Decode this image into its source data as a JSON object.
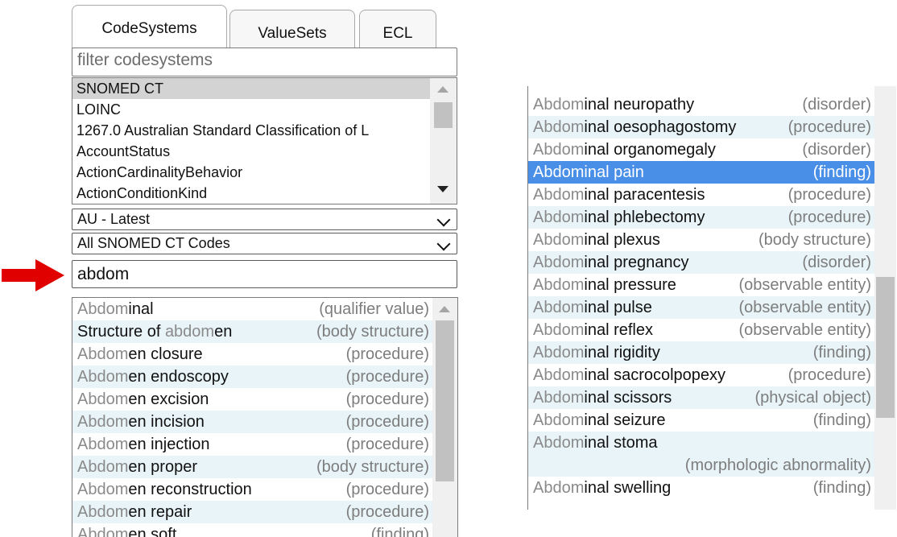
{
  "tabs": [
    {
      "label": "CodeSystems",
      "active": true
    },
    {
      "label": "ValueSets",
      "active": false
    },
    {
      "label": "ECL",
      "active": false
    }
  ],
  "filter": {
    "placeholder": "filter codesystems"
  },
  "codesystems": [
    {
      "label": "SNOMED CT",
      "selected": true
    },
    {
      "label": "LOINC"
    },
    {
      "label": "1267.0 Australian Standard Classification of L"
    },
    {
      "label": "AccountStatus"
    },
    {
      "label": "ActionCardinalityBehavior"
    },
    {
      "label": "ActionConditionKind"
    }
  ],
  "version_select": {
    "value": "AU - Latest"
  },
  "scope_select": {
    "value": "All SNOMED CT Codes"
  },
  "search": {
    "value": "abdom"
  },
  "colors": {
    "selected_row": "#4a8fe7",
    "alt_row": "#e8f4f8",
    "arrow": "#e00000"
  },
  "results_left": [
    {
      "pre": "",
      "match": "Abdom",
      "rest": "inal",
      "semantic": "(qualifier value)"
    },
    {
      "pre": "Structure of ",
      "match": "abdom",
      "rest": "en",
      "semantic": "(body structure)"
    },
    {
      "pre": "",
      "match": "Abdom",
      "rest": "en closure",
      "semantic": "(procedure)"
    },
    {
      "pre": "",
      "match": "Abdom",
      "rest": "en endoscopy",
      "semantic": "(procedure)"
    },
    {
      "pre": "",
      "match": "Abdom",
      "rest": "en excision",
      "semantic": "(procedure)"
    },
    {
      "pre": "",
      "match": "Abdom",
      "rest": "en incision",
      "semantic": "(procedure)"
    },
    {
      "pre": "",
      "match": "Abdom",
      "rest": "en injection",
      "semantic": "(procedure)"
    },
    {
      "pre": "",
      "match": "Abdom",
      "rest": "en proper",
      "semantic": "(body structure)"
    },
    {
      "pre": "",
      "match": "Abdom",
      "rest": "en reconstruction",
      "semantic": "(procedure)"
    },
    {
      "pre": "",
      "match": "Abdom",
      "rest": "en repair",
      "semantic": "(procedure)"
    },
    {
      "pre": "",
      "match": "Abdom",
      "rest": "en soft",
      "semantic": "(finding)"
    }
  ],
  "results_right": [
    {
      "pre": "",
      "match": "Abdom",
      "rest": "inal neuropathy",
      "semantic": "(disorder)"
    },
    {
      "pre": "",
      "match": "Abdom",
      "rest": "inal oesophagostomy",
      "semantic": "(procedure)"
    },
    {
      "pre": "",
      "match": "Abdom",
      "rest": "inal organomegaly",
      "semantic": "(disorder)"
    },
    {
      "pre": "",
      "match": "Abdom",
      "rest": "inal pain",
      "semantic": "(finding)",
      "selected": true
    },
    {
      "pre": "",
      "match": "Abdom",
      "rest": "inal paracentesis",
      "semantic": "(procedure)"
    },
    {
      "pre": "",
      "match": "Abdom",
      "rest": "inal phlebectomy",
      "semantic": "(procedure)"
    },
    {
      "pre": "",
      "match": "Abdom",
      "rest": "inal plexus",
      "semantic": "(body structure)"
    },
    {
      "pre": "",
      "match": "Abdom",
      "rest": "inal pregnancy",
      "semantic": "(disorder)"
    },
    {
      "pre": "",
      "match": "Abdom",
      "rest": "inal pressure",
      "semantic": "(observable entity)"
    },
    {
      "pre": "",
      "match": "Abdom",
      "rest": "inal pulse",
      "semantic": "(observable entity)"
    },
    {
      "pre": "",
      "match": "Abdom",
      "rest": "inal reflex",
      "semantic": "(observable entity)"
    },
    {
      "pre": "",
      "match": "Abdom",
      "rest": "inal rigidity",
      "semantic": "(finding)"
    },
    {
      "pre": "",
      "match": "Abdom",
      "rest": "inal sacrocolpopexy",
      "semantic": "(procedure)"
    },
    {
      "pre": "",
      "match": "Abdom",
      "rest": "inal scissors",
      "semantic": "(physical object)"
    },
    {
      "pre": "",
      "match": "Abdom",
      "rest": "inal seizure",
      "semantic": "(finding)"
    },
    {
      "pre": "",
      "match": "Abdom",
      "rest": "inal stoma",
      "semantic": "(morphologic abnormality)",
      "wrap": true
    },
    {
      "pre": "",
      "match": "Abdom",
      "rest": "inal swelling",
      "semantic": "(finding)"
    }
  ]
}
